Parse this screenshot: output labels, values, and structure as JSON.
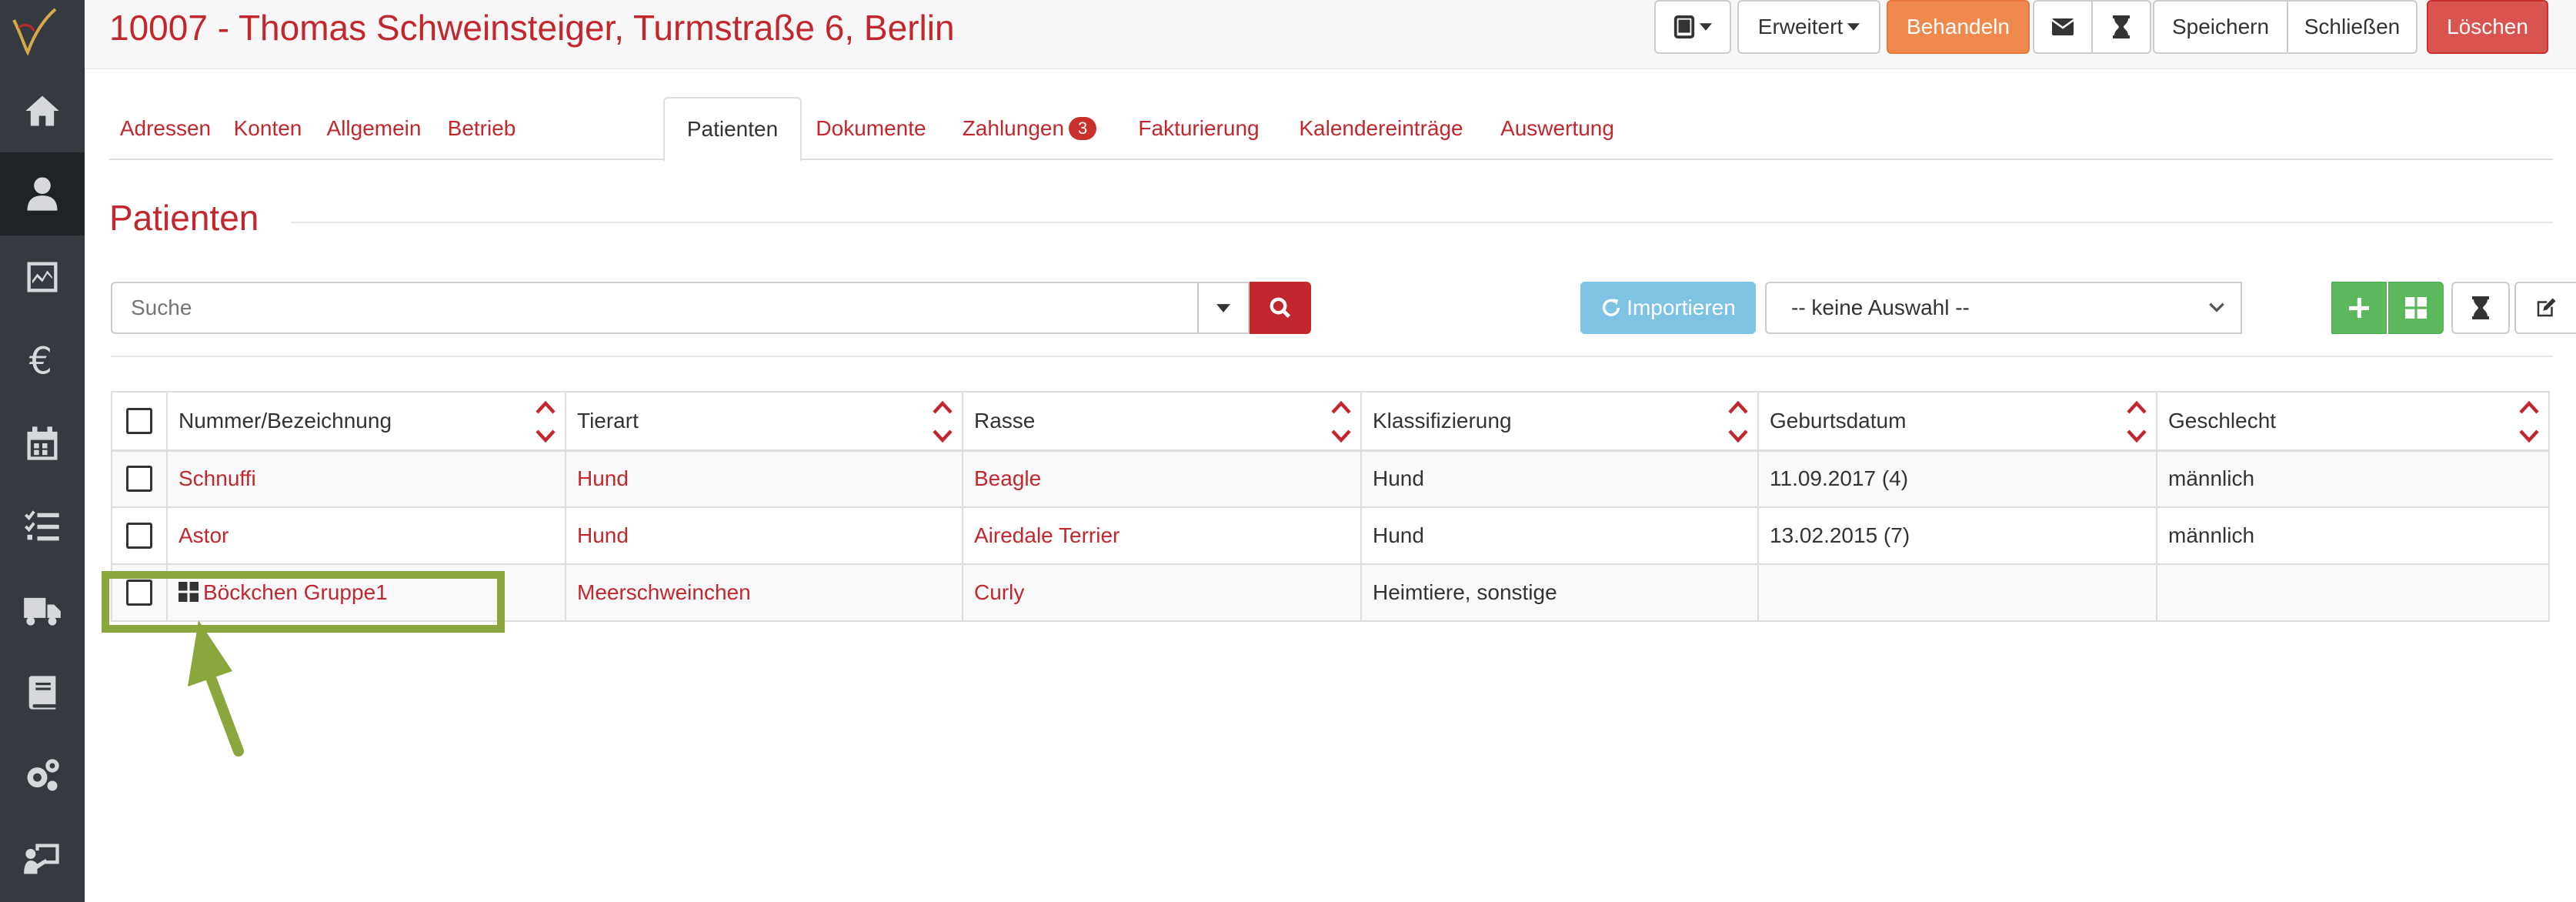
{
  "header": {
    "title": "10007 - Thomas Schweinsteiger, Turmstraße 6, Berlin",
    "buttons": {
      "erweitert": "Erweitert",
      "behandeln": "Behandeln",
      "speichern": "Speichern",
      "schliessen": "Schließen",
      "loeschen": "Löschen"
    }
  },
  "tabs": [
    {
      "label": "Adressen"
    },
    {
      "label": "Konten"
    },
    {
      "label": "Allgemein"
    },
    {
      "label": "Betrieb"
    },
    {
      "label": "Patienten",
      "active": true
    },
    {
      "label": "Dokumente"
    },
    {
      "label": "Zahlungen",
      "badge": "3"
    },
    {
      "label": "Fakturierung"
    },
    {
      "label": "Kalendereinträge"
    },
    {
      "label": "Auswertung"
    }
  ],
  "section": {
    "title": "Patienten"
  },
  "search": {
    "placeholder": "Suche"
  },
  "toolbar": {
    "import_label": "Importieren",
    "select_value": "-- keine Auswahl --"
  },
  "table": {
    "columns": [
      "Nummer/Bezeichnung",
      "Tierart",
      "Rasse",
      "Klassifizierung",
      "Geburtsdatum",
      "Geschlecht"
    ],
    "rows": [
      {
        "name": "Schnuffi",
        "tierart": "Hund",
        "rasse": "Beagle",
        "klass": "Hund",
        "geburt": "11.09.2017 (4)",
        "geschlecht": "männlich"
      },
      {
        "name": "Astor",
        "tierart": "Hund",
        "rasse": "Airedale Terrier",
        "klass": "Hund",
        "geburt": "13.02.2015 (7)",
        "geschlecht": "männlich"
      },
      {
        "name": "Böckchen Gruppe1",
        "tierart": "Meerschweinchen",
        "rasse": "Curly",
        "klass": "Heimtiere, sonstige",
        "geburt": "",
        "geschlecht": "",
        "group": true
      }
    ]
  },
  "colors": {
    "brand_red": "#c1272d",
    "orange": "#f0894e",
    "green": "#5cb85c",
    "info": "#7fc3e4",
    "highlight": "#8aa63c"
  }
}
